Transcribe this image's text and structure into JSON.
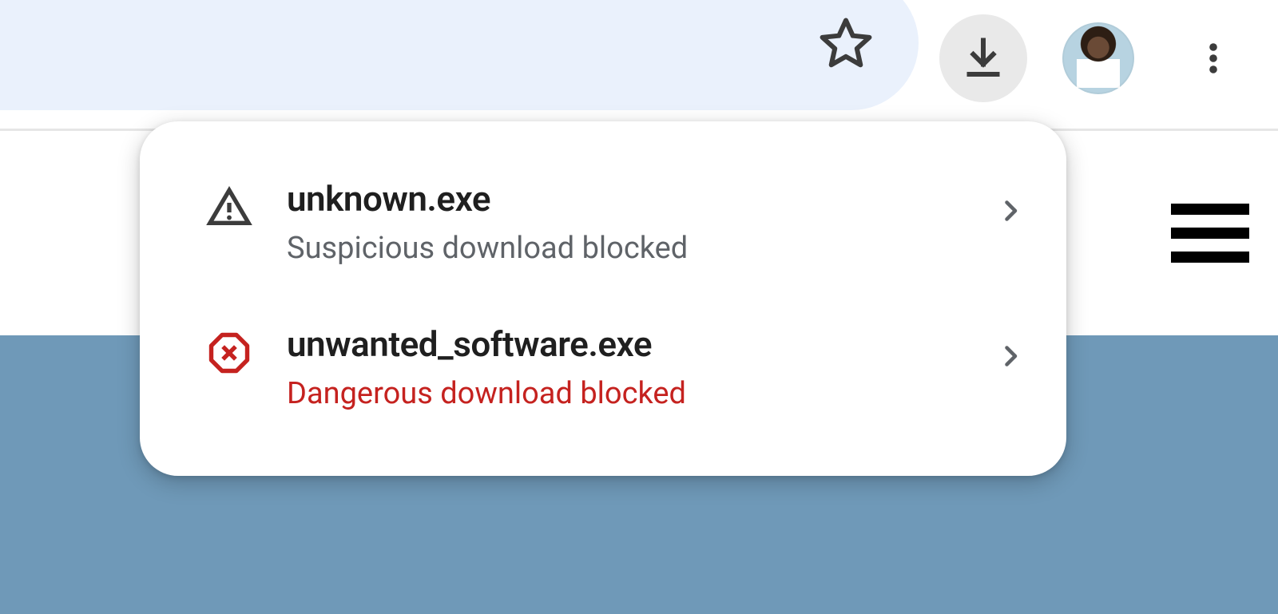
{
  "toolbar": {
    "star_icon": "star-outline",
    "downloads_icon": "download",
    "menu_icon": "more-vertical"
  },
  "downloads": {
    "items": [
      {
        "icon": "warning-triangle",
        "name": "unknown.exe",
        "status": "Suspicious download blocked",
        "status_kind": "warning"
      },
      {
        "icon": "danger-octagon",
        "name": "unwanted_software.exe",
        "status": "Dangerous download blocked",
        "status_kind": "danger"
      }
    ]
  },
  "colors": {
    "danger": "#c5221f",
    "muted": "#5f6368",
    "omnibox_bg": "#eaf1fc",
    "page_bg": "#6f99b8"
  }
}
